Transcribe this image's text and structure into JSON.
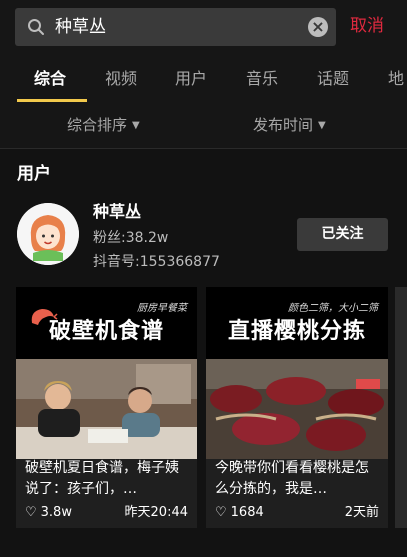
{
  "search": {
    "query": "种草丛",
    "cancel_label": "取消"
  },
  "tabs": [
    "综合",
    "视频",
    "用户",
    "音乐",
    "话题",
    "地"
  ],
  "filters": {
    "sort": "综合排序",
    "time": "发布时间"
  },
  "section": {
    "users_title": "用户"
  },
  "user": {
    "name": "种草丛",
    "fans": "粉丝:38.2w",
    "account_id": "抖音号:155366877",
    "follow_label": "已关注"
  },
  "videos": [
    {
      "headline": "破壁机食谱",
      "subtitle": "厨房早餐菜",
      "description": "破壁机夏日食谱，梅子姨说了：孩子们，…",
      "likes": "3.8w",
      "time": "昨天20:44"
    },
    {
      "headline": "直播樱桃分拣",
      "subtitle": "颜色二筛，大小二筛",
      "description": "今晚带你们看看樱桃是怎么分拣的，我是…",
      "likes": "1684",
      "time": "2天前"
    }
  ],
  "colors": {
    "accent": "#f2c94c",
    "cancel": "#e0293f",
    "background": "#121212"
  }
}
